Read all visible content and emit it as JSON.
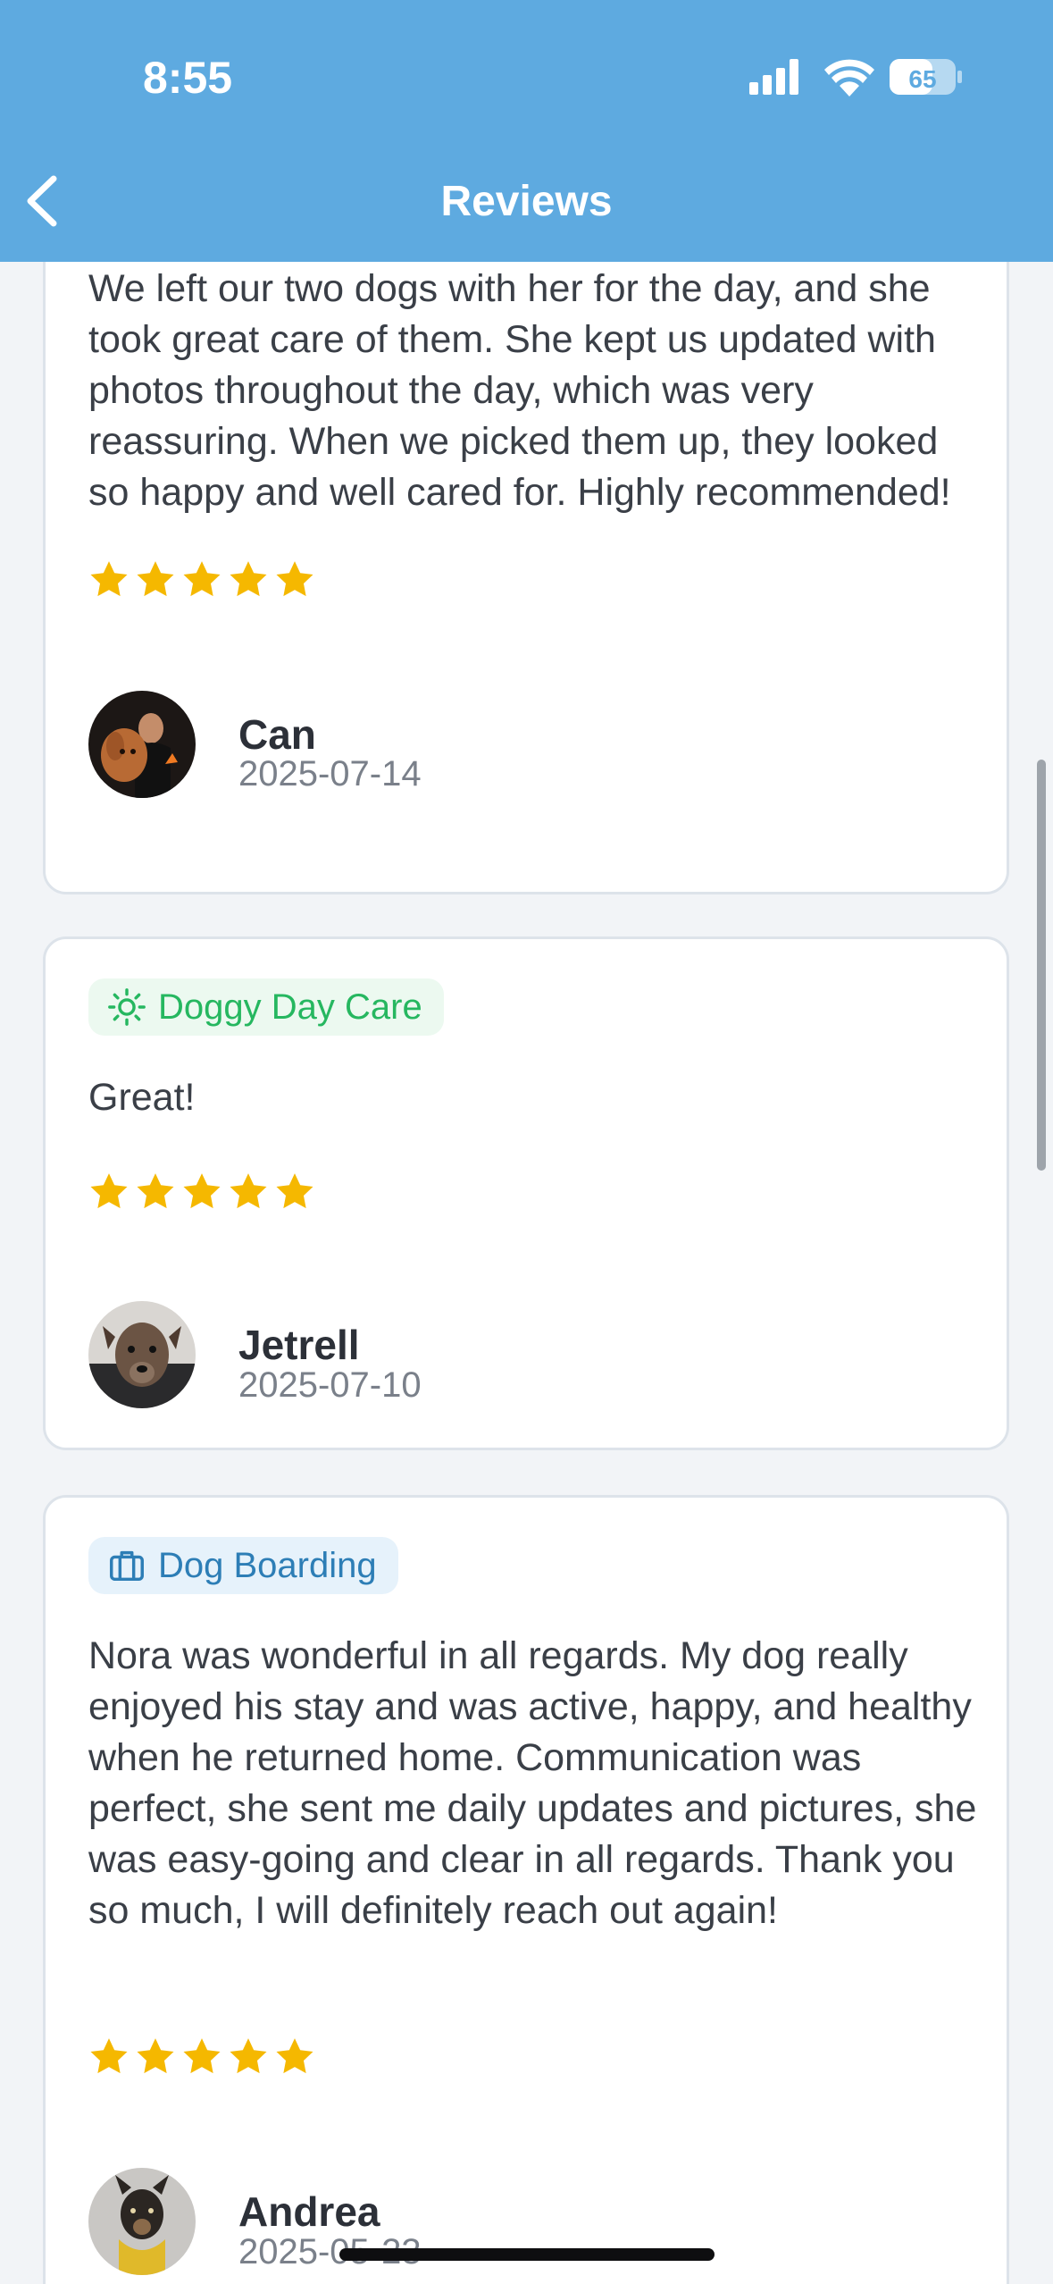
{
  "status_bar": {
    "time": "8:55",
    "battery": "65"
  },
  "nav": {
    "title": "Reviews"
  },
  "colors": {
    "header": "#5eaae0",
    "star": "#f5b800",
    "daycare_tag": "#26b760",
    "boarding_tag": "#2d7eb6"
  },
  "reviews": [
    {
      "text": "We left our two dogs with her for the day, and she took great care of them. She kept us updated with photos throughout the day, which was very reassuring. When we picked them up, they looked so happy and well cared for. Highly recommended!",
      "rating": 5,
      "reviewer": "Can",
      "date": "2025-07-14",
      "avatar_icon": "person-with-dog-avatar"
    },
    {
      "service": "Doggy Day Care",
      "service_icon": "sun-icon",
      "text": "Great!",
      "rating": 5,
      "reviewer": "Jetrell",
      "date": "2025-07-10",
      "avatar_icon": "brindle-puppy-avatar"
    },
    {
      "service": "Dog Boarding",
      "service_icon": "suitcase-icon",
      "text": "Nora was wonderful in all regards. My dog really enjoyed his stay and was active, happy, and healthy when he returned home. Communication was perfect, she sent me daily updates and pictures, she was easy-going and clear in all regards. Thank you so much, I will definitely reach out again!",
      "rating": 5,
      "reviewer": "Andrea",
      "date": "2025-05-23",
      "avatar_icon": "dog-with-bandana-avatar"
    }
  ]
}
